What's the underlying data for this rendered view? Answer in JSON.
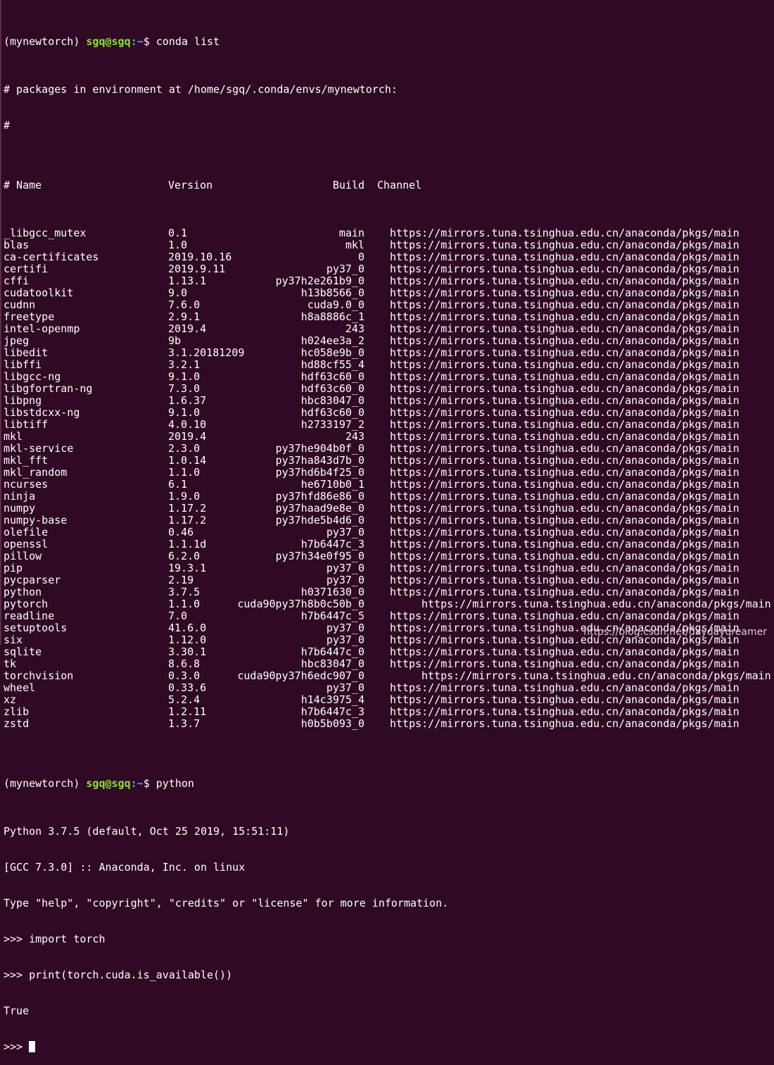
{
  "prompt": {
    "env": "(mynewtorch) ",
    "user_host": "sgq@sgq",
    "path": ":~",
    "symbol": "$ "
  },
  "commands": {
    "first": "conda list",
    "second": "python"
  },
  "header_lines": [
    "# packages in environment at /home/sgq/.conda/envs/mynewtorch:",
    "#"
  ],
  "table": {
    "columns": [
      "# Name",
      "Version",
      "Build",
      "Channel"
    ],
    "rows": [
      {
        "name": "_libgcc_mutex",
        "version": "0.1",
        "build": "main",
        "channel": "https://mirrors.tuna.tsinghua.edu.cn/anaconda/pkgs/main"
      },
      {
        "name": "blas",
        "version": "1.0",
        "build": "mkl",
        "channel": "https://mirrors.tuna.tsinghua.edu.cn/anaconda/pkgs/main"
      },
      {
        "name": "ca-certificates",
        "version": "2019.10.16",
        "build": "0",
        "channel": "https://mirrors.tuna.tsinghua.edu.cn/anaconda/pkgs/main"
      },
      {
        "name": "certifi",
        "version": "2019.9.11",
        "build": "py37_0",
        "channel": "https://mirrors.tuna.tsinghua.edu.cn/anaconda/pkgs/main"
      },
      {
        "name": "cffi",
        "version": "1.13.1",
        "build": "py37h2e261b9_0",
        "channel": "https://mirrors.tuna.tsinghua.edu.cn/anaconda/pkgs/main"
      },
      {
        "name": "cudatoolkit",
        "version": "9.0",
        "build": "h13b8566_0",
        "channel": "https://mirrors.tuna.tsinghua.edu.cn/anaconda/pkgs/main"
      },
      {
        "name": "cudnn",
        "version": "7.6.0",
        "build": "cuda9.0_0",
        "channel": "https://mirrors.tuna.tsinghua.edu.cn/anaconda/pkgs/main"
      },
      {
        "name": "freetype",
        "version": "2.9.1",
        "build": "h8a8886c_1",
        "channel": "https://mirrors.tuna.tsinghua.edu.cn/anaconda/pkgs/main"
      },
      {
        "name": "intel-openmp",
        "version": "2019.4",
        "build": "243",
        "channel": "https://mirrors.tuna.tsinghua.edu.cn/anaconda/pkgs/main"
      },
      {
        "name": "jpeg",
        "version": "9b",
        "build": "h024ee3a_2",
        "channel": "https://mirrors.tuna.tsinghua.edu.cn/anaconda/pkgs/main"
      },
      {
        "name": "libedit",
        "version": "3.1.20181209",
        "build": "hc058e9b_0",
        "channel": "https://mirrors.tuna.tsinghua.edu.cn/anaconda/pkgs/main"
      },
      {
        "name": "libffi",
        "version": "3.2.1",
        "build": "hd88cf55_4",
        "channel": "https://mirrors.tuna.tsinghua.edu.cn/anaconda/pkgs/main"
      },
      {
        "name": "libgcc-ng",
        "version": "9.1.0",
        "build": "hdf63c60_0",
        "channel": "https://mirrors.tuna.tsinghua.edu.cn/anaconda/pkgs/main"
      },
      {
        "name": "libgfortran-ng",
        "version": "7.3.0",
        "build": "hdf63c60_0",
        "channel": "https://mirrors.tuna.tsinghua.edu.cn/anaconda/pkgs/main"
      },
      {
        "name": "libpng",
        "version": "1.6.37",
        "build": "hbc83047_0",
        "channel": "https://mirrors.tuna.tsinghua.edu.cn/anaconda/pkgs/main"
      },
      {
        "name": "libstdcxx-ng",
        "version": "9.1.0",
        "build": "hdf63c60_0",
        "channel": "https://mirrors.tuna.tsinghua.edu.cn/anaconda/pkgs/main"
      },
      {
        "name": "libtiff",
        "version": "4.0.10",
        "build": "h2733197_2",
        "channel": "https://mirrors.tuna.tsinghua.edu.cn/anaconda/pkgs/main"
      },
      {
        "name": "mkl",
        "version": "2019.4",
        "build": "243",
        "channel": "https://mirrors.tuna.tsinghua.edu.cn/anaconda/pkgs/main"
      },
      {
        "name": "mkl-service",
        "version": "2.3.0",
        "build": "py37he904b0f_0",
        "channel": "https://mirrors.tuna.tsinghua.edu.cn/anaconda/pkgs/main"
      },
      {
        "name": "mkl_fft",
        "version": "1.0.14",
        "build": "py37ha843d7b_0",
        "channel": "https://mirrors.tuna.tsinghua.edu.cn/anaconda/pkgs/main"
      },
      {
        "name": "mkl_random",
        "version": "1.1.0",
        "build": "py37hd6b4f25_0",
        "channel": "https://mirrors.tuna.tsinghua.edu.cn/anaconda/pkgs/main"
      },
      {
        "name": "ncurses",
        "version": "6.1",
        "build": "he6710b0_1",
        "channel": "https://mirrors.tuna.tsinghua.edu.cn/anaconda/pkgs/main"
      },
      {
        "name": "ninja",
        "version": "1.9.0",
        "build": "py37hfd86e86_0",
        "channel": "https://mirrors.tuna.tsinghua.edu.cn/anaconda/pkgs/main"
      },
      {
        "name": "numpy",
        "version": "1.17.2",
        "build": "py37haad9e8e_0",
        "channel": "https://mirrors.tuna.tsinghua.edu.cn/anaconda/pkgs/main"
      },
      {
        "name": "numpy-base",
        "version": "1.17.2",
        "build": "py37hde5b4d6_0",
        "channel": "https://mirrors.tuna.tsinghua.edu.cn/anaconda/pkgs/main"
      },
      {
        "name": "olefile",
        "version": "0.46",
        "build": "py37_0",
        "channel": "https://mirrors.tuna.tsinghua.edu.cn/anaconda/pkgs/main"
      },
      {
        "name": "openssl",
        "version": "1.1.1d",
        "build": "h7b6447c_3",
        "channel": "https://mirrors.tuna.tsinghua.edu.cn/anaconda/pkgs/main"
      },
      {
        "name": "pillow",
        "version": "6.2.0",
        "build": "py37h34e0f95_0",
        "channel": "https://mirrors.tuna.tsinghua.edu.cn/anaconda/pkgs/main"
      },
      {
        "name": "pip",
        "version": "19.3.1",
        "build": "py37_0",
        "channel": "https://mirrors.tuna.tsinghua.edu.cn/anaconda/pkgs/main"
      },
      {
        "name": "pycparser",
        "version": "2.19",
        "build": "py37_0",
        "channel": "https://mirrors.tuna.tsinghua.edu.cn/anaconda/pkgs/main"
      },
      {
        "name": "python",
        "version": "3.7.5",
        "build": "h0371630_0",
        "channel": "https://mirrors.tuna.tsinghua.edu.cn/anaconda/pkgs/main"
      },
      {
        "name": "pytorch",
        "version": "1.1.0",
        "build": "cuda90py37h8b0c50b_0",
        "channel": "https://mirrors.tuna.tsinghua.edu.cn/anaconda/pkgs/main",
        "shift": true
      },
      {
        "name": "readline",
        "version": "7.0",
        "build": "h7b6447c_5",
        "channel": "https://mirrors.tuna.tsinghua.edu.cn/anaconda/pkgs/main"
      },
      {
        "name": "setuptools",
        "version": "41.6.0",
        "build": "py37_0",
        "channel": "https://mirrors.tuna.tsinghua.edu.cn/anaconda/pkgs/main"
      },
      {
        "name": "six",
        "version": "1.12.0",
        "build": "py37_0",
        "channel": "https://mirrors.tuna.tsinghua.edu.cn/anaconda/pkgs/main"
      },
      {
        "name": "sqlite",
        "version": "3.30.1",
        "build": "h7b6447c_0",
        "channel": "https://mirrors.tuna.tsinghua.edu.cn/anaconda/pkgs/main"
      },
      {
        "name": "tk",
        "version": "8.6.8",
        "build": "hbc83047_0",
        "channel": "https://mirrors.tuna.tsinghua.edu.cn/anaconda/pkgs/main"
      },
      {
        "name": "torchvision",
        "version": "0.3.0",
        "build": "cuda90py37h6edc907_0",
        "channel": "https://mirrors.tuna.tsinghua.edu.cn/anaconda/pkgs/main",
        "shift": true
      },
      {
        "name": "wheel",
        "version": "0.33.6",
        "build": "py37_0",
        "channel": "https://mirrors.tuna.tsinghua.edu.cn/anaconda/pkgs/main"
      },
      {
        "name": "xz",
        "version": "5.2.4",
        "build": "h14c3975_4",
        "channel": "https://mirrors.tuna.tsinghua.edu.cn/anaconda/pkgs/main"
      },
      {
        "name": "zlib",
        "version": "1.2.11",
        "build": "h7b6447c_3",
        "channel": "https://mirrors.tuna.tsinghua.edu.cn/anaconda/pkgs/main"
      },
      {
        "name": "zstd",
        "version": "1.3.7",
        "build": "h0b5b093_0",
        "channel": "https://mirrors.tuna.tsinghua.edu.cn/anaconda/pkgs/main"
      }
    ]
  },
  "python_output": [
    "Python 3.7.5 (default, Oct 25 2019, 15:51:11)",
    "[GCC 7.3.0] :: Anaconda, Inc. on linux",
    "Type \"help\", \"copyright\", \"credits\" or \"license\" for more information.",
    ">>> import torch",
    ">>> print(torch.cuda.is_available())",
    "True"
  ],
  "repl_prompt": ">>> ",
  "watermark": "https://blog.csdn.net/daydaydreamer",
  "colors": {
    "background": "#300a24",
    "text": "#ffffff",
    "user_host": "#8ae234",
    "path": "#729fcf"
  }
}
